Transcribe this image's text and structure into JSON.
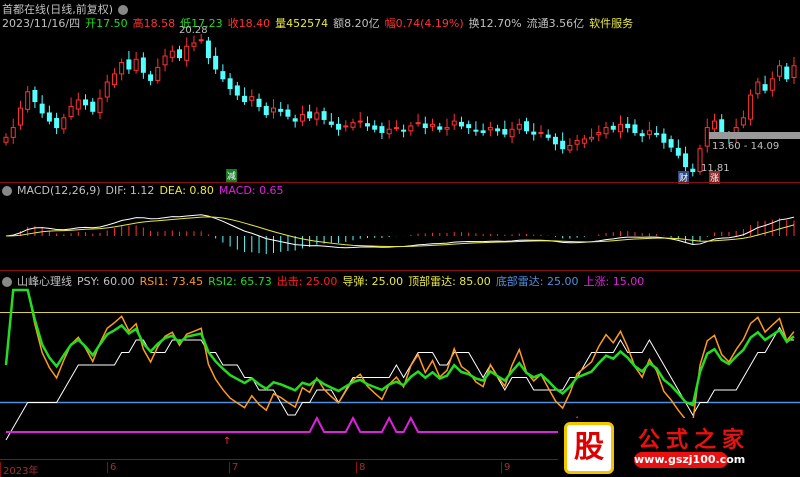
{
  "header": {
    "title": "首都在线(日线,前复权)",
    "date": "2023/11/16/四",
    "open": "开17.50",
    "high": "高18.58",
    "low": "低17.23",
    "close": "收18.40",
    "volume": "量452574",
    "amount": "额8.20亿",
    "change": "幅0.74(4.19%)",
    "turnover": "换12.70%",
    "float": "流通3.56亿",
    "sector": "软件服务"
  },
  "price_labels": {
    "max": "20.28",
    "min": "11.81",
    "range": "13.60 - 14.09",
    "tag_cai": "财",
    "tag_zhang": "涨",
    "tag_gu": "减"
  },
  "macd": {
    "name": "MACD(12,26,9)",
    "dif": "DIF: 1.12",
    "dea": "DEA: 0.80",
    "macd": "MACD: 0.65"
  },
  "psy": {
    "name": "山峰心理线",
    "psy": "PSY: 60.00",
    "rsi1": "RSI1: 73.45",
    "rsi2": "RSI2: 65.73",
    "chuji": "出击: 25.00",
    "daotan": "导弹: 25.00",
    "top": "顶部雷达: 85.00",
    "bottom": "底部雷达: 25.00",
    "up": "上涨: 15.00"
  },
  "axis": [
    "2023年",
    "6",
    "7",
    "8",
    "9"
  ],
  "watermark": {
    "logo": "股",
    "title": "公式之家",
    "url": "www.gszj100.com"
  },
  "colors": {
    "up": "#ff3232",
    "down": "#54ffff",
    "dif": "#ffffff",
    "dea": "#e8e840",
    "rsi1": "#ff9a20",
    "rsi2": "#22dd22",
    "psy": "#ffffff",
    "top": "#e0d040",
    "bottom": "#5090e0",
    "up_line": "#e020e0"
  },
  "chart_data": {
    "type": "candlestick",
    "closes": [
      14.0,
      14.6,
      15.8,
      16.8,
      16.2,
      15.5,
      15.0,
      14.6,
      15.2,
      15.9,
      16.3,
      16.0,
      15.6,
      16.4,
      17.4,
      17.9,
      18.6,
      18.2,
      18.8,
      18.0,
      17.5,
      18.3,
      19.0,
      19.3,
      18.9,
      19.6,
      19.8,
      20.0,
      18.9,
      18.2,
      17.6,
      17.0,
      16.6,
      16.2,
      16.5,
      15.9,
      15.4,
      15.8,
      15.6,
      15.3,
      15.0,
      15.4,
      15.2,
      15.5,
      15.1,
      14.8,
      14.5,
      14.7,
      14.9,
      15.0,
      14.7,
      14.5,
      14.3,
      14.5,
      14.6,
      14.4,
      14.7,
      14.9,
      14.6,
      14.8,
      14.5,
      14.6,
      15.0,
      14.7,
      14.6,
      14.4,
      14.3,
      14.6,
      14.4,
      14.2,
      14.5,
      14.8,
      14.4,
      14.2,
      14.3,
      14.0,
      13.6,
      13.3,
      13.5,
      13.8,
      13.9,
      14.0,
      14.3,
      14.6,
      14.5,
      14.8,
      14.6,
      14.3,
      14.1,
      14.4,
      14.2,
      13.7,
      13.4,
      12.9,
      12.2,
      11.9,
      13.3,
      14.6,
      15.0,
      14.3,
      14.0,
      14.6,
      15.2,
      16.6,
      17.4,
      16.9,
      17.6,
      18.4,
      17.6,
      18.4
    ],
    "price_range": [
      11.5,
      20.6
    ]
  }
}
